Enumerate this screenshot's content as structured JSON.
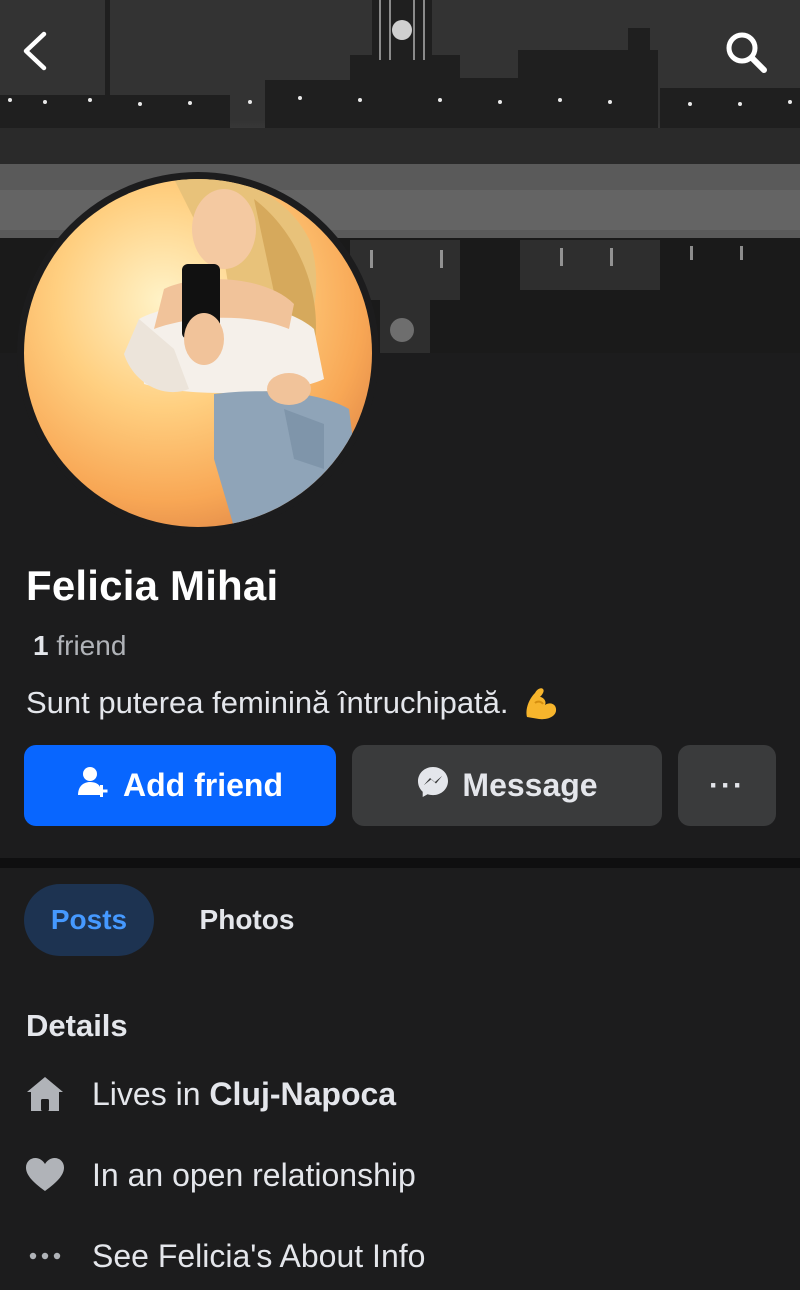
{
  "header": {
    "back_icon": "chevron-left-icon",
    "search_icon": "search-icon"
  },
  "profile": {
    "name": "Felicia Mihai",
    "friends_count": "1",
    "friends_label": "friend",
    "bio": "Sunt puterea feminină întruchipată.",
    "bio_emoji": "flexed-biceps-emoji"
  },
  "actions": {
    "add_friend_label": "Add friend",
    "message_label": "Message",
    "more_label": "···"
  },
  "tabs": [
    {
      "label": "Posts",
      "active": true
    },
    {
      "label": "Photos",
      "active": false
    }
  ],
  "details": {
    "title": "Details",
    "lives_prefix": "Lives in",
    "lives_city": "Cluj-Napoca",
    "relationship": "In an open relationship",
    "about_link": "See Felicia's About Info"
  },
  "colors": {
    "background": "#1c1c1d",
    "primary_button": "#0866ff",
    "secondary_button": "#3a3b3c",
    "active_tab_bg": "#1d3351",
    "active_tab_text": "#4599ff"
  }
}
